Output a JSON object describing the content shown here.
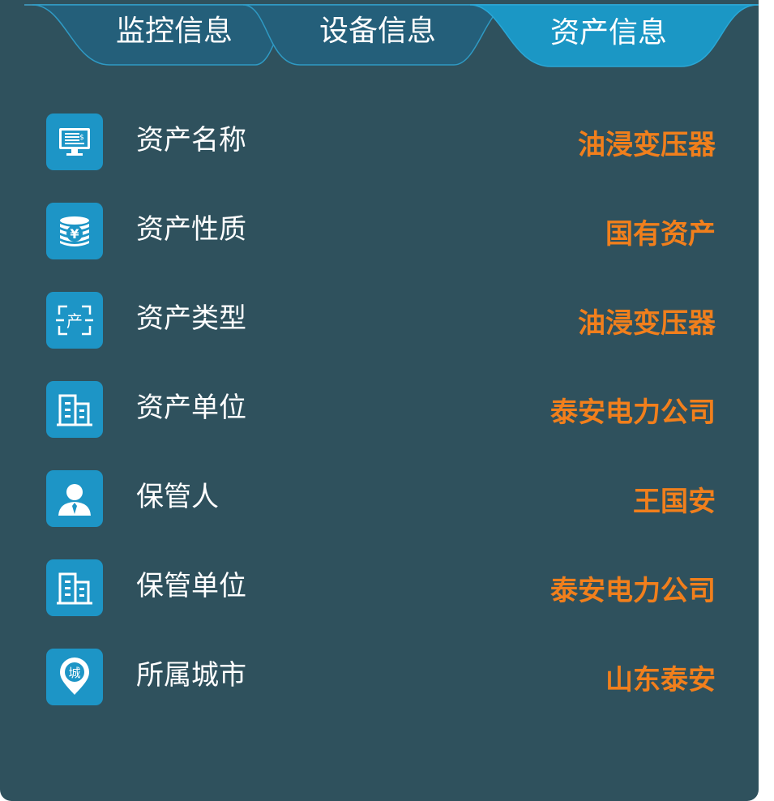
{
  "colors": {
    "panel_bg": "#2f515d",
    "tab_inactive": "#245f7a",
    "tab_active": "#1b97c5",
    "icon_bg": "#1d95c6",
    "label": "#ffffff",
    "value": "#f17f1c"
  },
  "tabs": [
    {
      "label": "监控信息",
      "active": false
    },
    {
      "label": "设备信息",
      "active": false
    },
    {
      "label": "资产信息",
      "active": true
    }
  ],
  "rows": [
    {
      "icon": "monitor-icon",
      "label": "资产名称",
      "value": "油浸变压器"
    },
    {
      "icon": "coins-yen-icon",
      "label": "资产性质",
      "value": "国有资产"
    },
    {
      "icon": "asset-type-icon",
      "label": "资产类型",
      "value": "油浸变压器"
    },
    {
      "icon": "building-icon",
      "label": "资产单位",
      "value": "泰安电力公司"
    },
    {
      "icon": "person-icon",
      "label": "保管人",
      "value": "王国安"
    },
    {
      "icon": "building-icon",
      "label": "保管单位",
      "value": "泰安电力公司"
    },
    {
      "icon": "location-pin-icon",
      "label": "所属城市",
      "value": "山东泰安",
      "pin_text": "城"
    }
  ]
}
